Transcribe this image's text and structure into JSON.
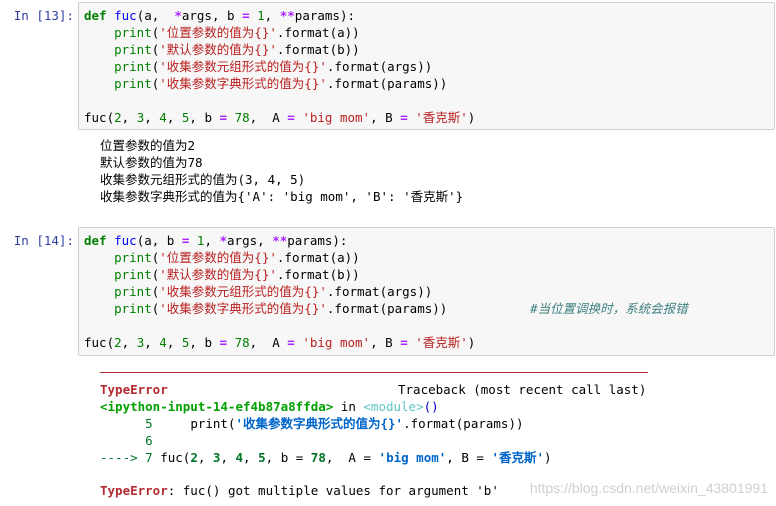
{
  "cell13": {
    "prompt": "In [13]:",
    "lines": [
      {
        "segs": [
          [
            "kw",
            "def "
          ],
          [
            "fn",
            "fuc"
          ],
          [
            "",
            "(a,  "
          ],
          [
            "op",
            "*"
          ],
          [
            "",
            "args, b "
          ],
          [
            "op",
            "="
          ],
          [
            "num",
            " 1"
          ],
          [
            "",
            ", "
          ],
          [
            "op",
            "**"
          ],
          [
            "",
            "params):"
          ]
        ]
      },
      {
        "segs": [
          [
            "",
            "    "
          ],
          [
            "bi",
            "print"
          ],
          [
            "",
            "("
          ],
          [
            "str",
            "'位置参数的值为{}'"
          ],
          [
            "",
            ".format(a))"
          ]
        ]
      },
      {
        "segs": [
          [
            "",
            "    "
          ],
          [
            "bi",
            "print"
          ],
          [
            "",
            "("
          ],
          [
            "str",
            "'默认参数的值为{}'"
          ],
          [
            "",
            ".format(b))"
          ]
        ]
      },
      {
        "segs": [
          [
            "",
            "    "
          ],
          [
            "bi",
            "print"
          ],
          [
            "",
            "("
          ],
          [
            "str",
            "'收集参数元组形式的值为{}'"
          ],
          [
            "",
            ".format(args))"
          ]
        ]
      },
      {
        "segs": [
          [
            "",
            "    "
          ],
          [
            "bi",
            "print"
          ],
          [
            "",
            "("
          ],
          [
            "str",
            "'收集参数字典形式的值为{}'"
          ],
          [
            "",
            ".format(params))"
          ]
        ]
      },
      {
        "segs": []
      },
      {
        "segs": [
          [
            "",
            "fuc("
          ],
          [
            "num",
            "2"
          ],
          [
            "",
            ", "
          ],
          [
            "num",
            "3"
          ],
          [
            "",
            ", "
          ],
          [
            "num",
            "4"
          ],
          [
            "",
            ", "
          ],
          [
            "num",
            "5"
          ],
          [
            "",
            ", b "
          ],
          [
            "op",
            "="
          ],
          [
            "num",
            " 78"
          ],
          [
            "",
            ",  A "
          ],
          [
            "op",
            "="
          ],
          [
            "str",
            " 'big mom'"
          ],
          [
            "",
            ", B "
          ],
          [
            "op",
            "="
          ],
          [
            "str",
            " '香克斯'"
          ],
          [
            "",
            ")"
          ]
        ]
      }
    ],
    "output": [
      "位置参数的值为2",
      "默认参数的值为78",
      "收集参数元组形式的值为(3, 4, 5)",
      "收集参数字典形式的值为{'A': 'big mom', 'B': '香克斯'}"
    ]
  },
  "cell14": {
    "prompt": "In [14]:",
    "lines": [
      {
        "segs": [
          [
            "kw",
            "def "
          ],
          [
            "fn",
            "fuc"
          ],
          [
            "",
            "(a, b "
          ],
          [
            "op",
            "="
          ],
          [
            "num",
            " 1"
          ],
          [
            "",
            ", "
          ],
          [
            "op",
            "*"
          ],
          [
            "",
            "args, "
          ],
          [
            "op",
            "**"
          ],
          [
            "",
            "params):"
          ]
        ]
      },
      {
        "segs": [
          [
            "",
            "    "
          ],
          [
            "bi",
            "print"
          ],
          [
            "",
            "("
          ],
          [
            "str",
            "'位置参数的值为{}'"
          ],
          [
            "",
            ".format(a))"
          ]
        ]
      },
      {
        "segs": [
          [
            "",
            "    "
          ],
          [
            "bi",
            "print"
          ],
          [
            "",
            "("
          ],
          [
            "str",
            "'默认参数的值为{}'"
          ],
          [
            "",
            ".format(b))"
          ]
        ]
      },
      {
        "segs": [
          [
            "",
            "    "
          ],
          [
            "bi",
            "print"
          ],
          [
            "",
            "("
          ],
          [
            "str",
            "'收集参数元组形式的值为{}'"
          ],
          [
            "",
            ".format(args))"
          ]
        ]
      },
      {
        "segs": [
          [
            "",
            "    "
          ],
          [
            "bi",
            "print"
          ],
          [
            "",
            "("
          ],
          [
            "str",
            "'收集参数字典形式的值为{}'"
          ],
          [
            "",
            ".format(params))"
          ],
          [
            "",
            "           "
          ],
          [
            "com",
            "#当位置调换时，系统会报错"
          ]
        ]
      },
      {
        "segs": []
      },
      {
        "segs": [
          [
            "",
            "fuc("
          ],
          [
            "num",
            "2"
          ],
          [
            "",
            ", "
          ],
          [
            "num",
            "3"
          ],
          [
            "",
            ", "
          ],
          [
            "num",
            "4"
          ],
          [
            "",
            ", "
          ],
          [
            "num",
            "5"
          ],
          [
            "",
            ", b "
          ],
          [
            "op",
            "="
          ],
          [
            "num",
            " 78"
          ],
          [
            "",
            ",  A "
          ],
          [
            "op",
            "="
          ],
          [
            "str",
            " 'big mom'"
          ],
          [
            "",
            ", B "
          ],
          [
            "op",
            "="
          ],
          [
            "str",
            " '香克斯'"
          ],
          [
            "",
            ")"
          ]
        ]
      }
    ],
    "traceback": {
      "error_name": "TypeError",
      "traceback_label": "Traceback (most recent call last)",
      "input_ref": "<ipython-input-14-ef4b87a8ffda>",
      "in_word": " in ",
      "module": "<module>",
      "module_parens": "()",
      "line5_no": "      5",
      "line5_code_pre": "     print(",
      "line5_str": "'收集参数字典形式的值为{}'",
      "line5_code_post": ".format(params))",
      "line6_no": "      6",
      "arrow": "----> 7",
      "line7_code": [
        [
          "",
          "fuc("
        ],
        [
          "bnum",
          "2"
        ],
        [
          "",
          ", "
        ],
        [
          "bnum",
          "3"
        ],
        [
          "",
          ", "
        ],
        [
          "bnum",
          "4"
        ],
        [
          "",
          ", "
        ],
        [
          "bnum",
          "5"
        ],
        [
          "",
          ", b "
        ],
        [
          "",
          "="
        ],
        [
          "bnum",
          " 78"
        ],
        [
          "",
          ",  A "
        ],
        [
          "",
          "="
        ],
        [
          "bstr",
          " 'big mom'"
        ],
        [
          "",
          ", B "
        ],
        [
          "",
          "="
        ],
        [
          "bstr",
          " '香克斯'"
        ],
        [
          "",
          ")"
        ]
      ],
      "final_error": "TypeError",
      "final_msg": ": fuc() got multiple values for argument 'b'"
    }
  },
  "watermark": "https://blog.csdn.net/weixin_43801991"
}
